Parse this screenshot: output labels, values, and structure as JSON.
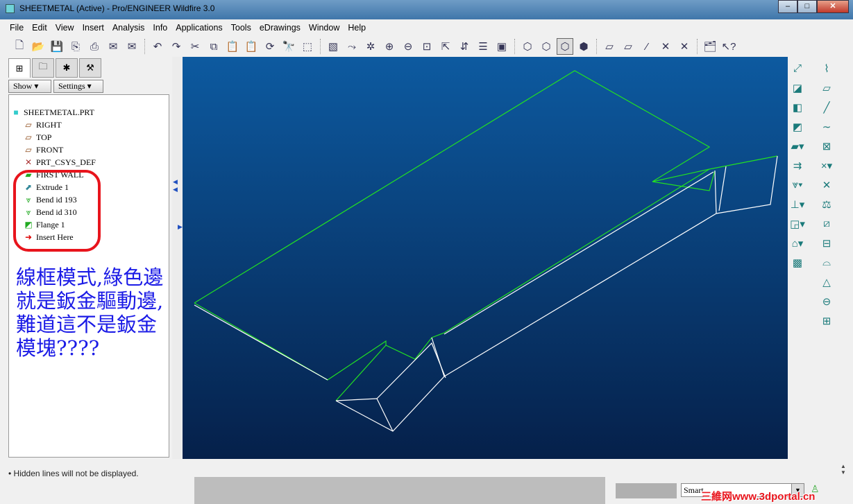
{
  "window": {
    "title": "SHEETMETAL (Active) - Pro/ENGINEER Wildfire 3.0",
    "minimize": "–",
    "maximize": "□",
    "close": "✕"
  },
  "menu": [
    "File",
    "Edit",
    "View",
    "Insert",
    "Analysis",
    "Info",
    "Applications",
    "Tools",
    "eDrawings",
    "Window",
    "Help"
  ],
  "panel": {
    "show_label": "Show ▾",
    "settings_label": "Settings ▾"
  },
  "tree": {
    "root": "SHEETMETAL.PRT",
    "items": [
      {
        "label": "RIGHT",
        "icon": "datum-plane-icon"
      },
      {
        "label": "TOP",
        "icon": "datum-plane-icon"
      },
      {
        "label": "FRONT",
        "icon": "datum-plane-icon"
      },
      {
        "label": "PRT_CSYS_DEF",
        "icon": "csys-icon"
      },
      {
        "label": "FIRST WALL",
        "icon": "wall-icon"
      },
      {
        "label": "Extrude 1",
        "icon": "extrude-icon"
      },
      {
        "label": "Bend id 193",
        "icon": "bend-icon"
      },
      {
        "label": "Bend id 310",
        "icon": "bend-icon"
      },
      {
        "label": "Flange 1",
        "icon": "flange-icon"
      },
      {
        "label": "Insert Here",
        "icon": "arrow-icon"
      }
    ]
  },
  "annotation": "線框模式,綠色邊就是鈑金驅動邊,難道這不是鈑金模塊????",
  "status": {
    "message": "• Hidden lines will not be displayed.",
    "filter": "Smart"
  },
  "watermark": "三維网www.3dportal.cn",
  "colors": {
    "accent_green": "#22e022",
    "annotation_blue": "#1b1be6",
    "highlight_red": "#e8141c"
  }
}
